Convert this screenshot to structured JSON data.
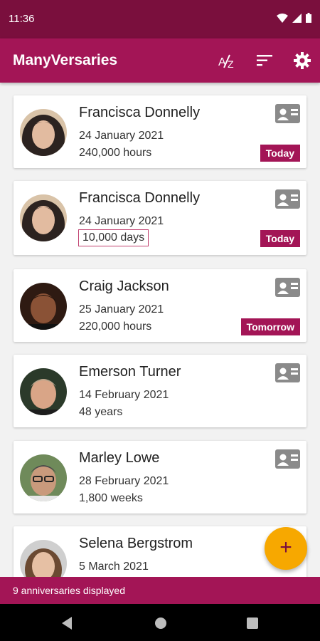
{
  "status": {
    "time": "11:36"
  },
  "app": {
    "title": "ManyVersaries"
  },
  "anniversaries": [
    {
      "name": "Francisca Donnelly",
      "date": "24 January 2021",
      "duration": "240,000 hours",
      "badge": "Today"
    },
    {
      "name": "Francisca Donnelly",
      "date": "24 January 2021",
      "duration": "10,000 days",
      "badge": "Today"
    },
    {
      "name": "Craig Jackson",
      "date": "25 January 2021",
      "duration": "220,000 hours",
      "badge": "Tomorrow"
    },
    {
      "name": "Emerson Turner",
      "date": "14 February 2021",
      "duration": "48 years"
    },
    {
      "name": "Marley Lowe",
      "date": "28 February 2021",
      "duration": "1,800 weeks"
    },
    {
      "name": "Selena Bergstrom",
      "date": "5 March 2021"
    }
  ],
  "fab": {
    "label": "+"
  },
  "footer": {
    "text": "9 anniversaries displayed"
  },
  "colors": {
    "primary": "#a31556",
    "primary_dark": "#7a0f3d",
    "accent": "#f7a800"
  }
}
